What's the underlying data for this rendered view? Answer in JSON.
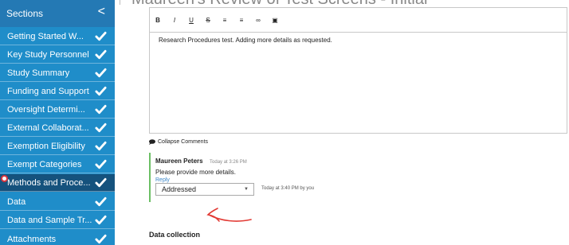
{
  "title_fragment": "Maureen's Review of Test Screens - Initial",
  "sidebar": {
    "header": "Sections",
    "collapse_glyph": "<",
    "items": [
      {
        "label": "Getting Started W..."
      },
      {
        "label": "Key Study Personnel"
      },
      {
        "label": "Study Summary"
      },
      {
        "label": "Funding and Support"
      },
      {
        "label": "Oversight Determi..."
      },
      {
        "label": "External Collaborat..."
      },
      {
        "label": "Exemption Eligibility"
      },
      {
        "label": "Exempt Categories"
      },
      {
        "label": "Methods and Proce..."
      },
      {
        "label": "Data"
      },
      {
        "label": "Data and Sample Tr..."
      },
      {
        "label": "Attachments"
      }
    ]
  },
  "toolbar": {
    "bold": "B",
    "italic": "I",
    "underline": "U",
    "strike": "S",
    "bullets": "≡",
    "numbered": "≡",
    "link": "∞",
    "image": "▣"
  },
  "editor": {
    "text": "Research Procedures test.  Adding more details as requested."
  },
  "comments": {
    "collapse_label": "Collapse Comments",
    "author": "Maureen Peters",
    "time": "Today at 3:26 PM",
    "text": "Please provide more details.",
    "reply_label": "Reply",
    "status_value": "Addressed",
    "status_note": "Today at 3:40 PM by you"
  },
  "section_heading": "Data collection",
  "colors": {
    "sidebar_bg": "#1f8dc9",
    "sidebar_active": "#15527d",
    "comment_bar": "#6cbf65",
    "annotation": "#e23a34"
  }
}
